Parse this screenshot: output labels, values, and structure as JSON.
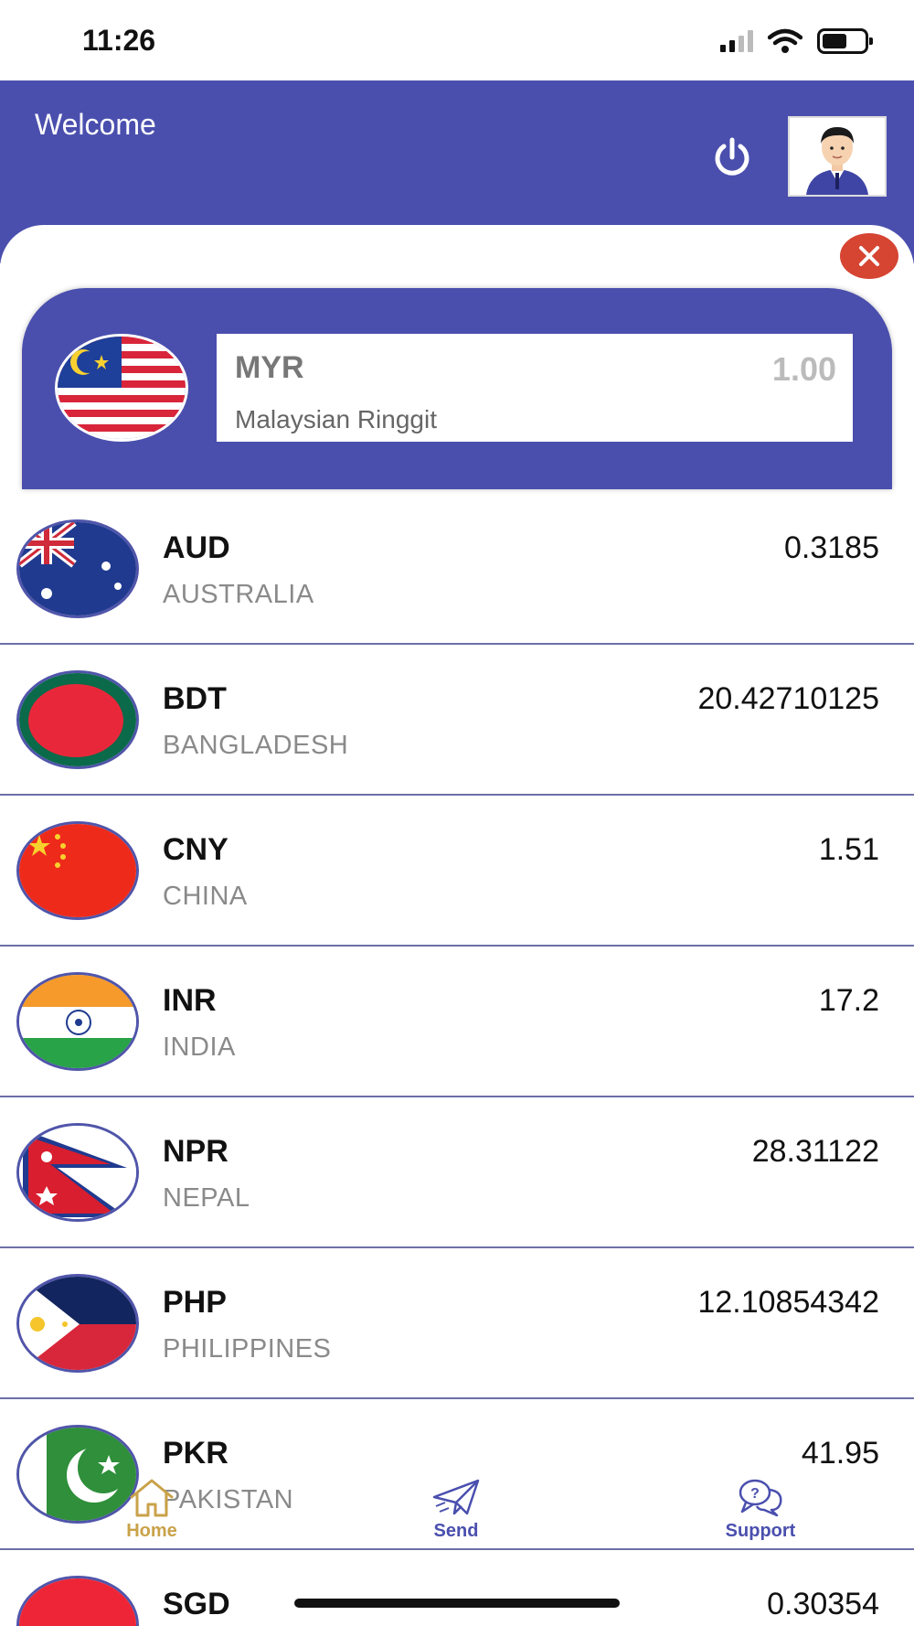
{
  "status_bar": {
    "time": "11:26"
  },
  "header": {
    "welcome": "Welcome"
  },
  "base": {
    "code": "MYR",
    "name": "Malaysian Ringgit",
    "value": "1.00"
  },
  "rates": [
    {
      "code": "AUD",
      "country": "AUSTRALIA",
      "value": "0.3185"
    },
    {
      "code": "BDT",
      "country": "BANGLADESH",
      "value": "20.42710125"
    },
    {
      "code": "CNY",
      "country": "CHINA",
      "value": "1.51"
    },
    {
      "code": "INR",
      "country": "INDIA",
      "value": "17.2"
    },
    {
      "code": "NPR",
      "country": "NEPAL",
      "value": "28.31122"
    },
    {
      "code": "PHP",
      "country": "PHILIPPINES",
      "value": "12.10854342"
    },
    {
      "code": "PKR",
      "country": "PAKISTAN",
      "value": "41.95"
    },
    {
      "code": "SGD",
      "country": "",
      "value": "0.30354"
    }
  ],
  "nav": {
    "home": "Home",
    "send": "Send",
    "support": "Support"
  },
  "colors": {
    "primary": "#4a4fae",
    "accent_home": "#c9a24a",
    "close": "#d64432"
  }
}
